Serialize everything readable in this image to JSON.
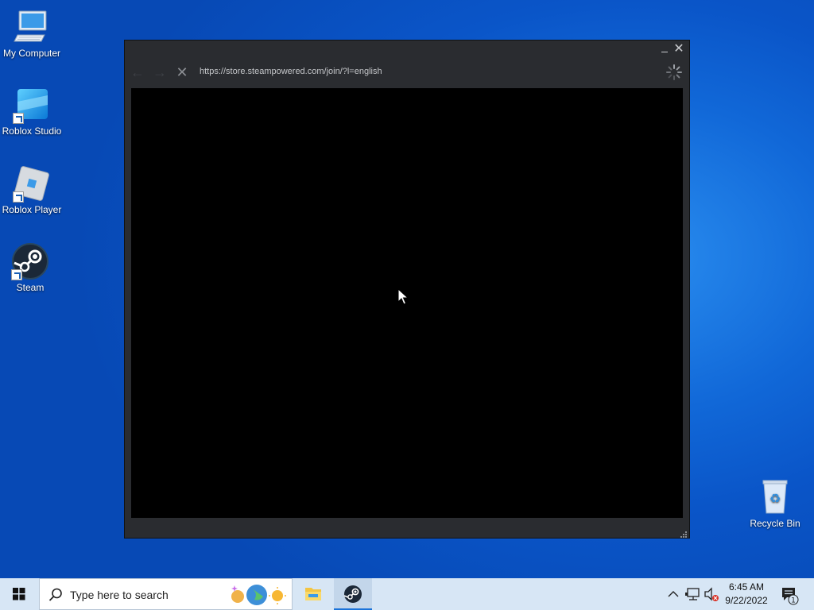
{
  "desktop": {
    "icons": [
      {
        "label": "My Computer"
      },
      {
        "label": "Roblox Studio"
      },
      {
        "label": "Roblox Player"
      },
      {
        "label": "Steam"
      },
      {
        "label": "Recycle Bin"
      }
    ]
  },
  "steam_window": {
    "minimize_glyph": "_",
    "close_glyph": "✕",
    "back_glyph": "←",
    "forward_glyph": "→",
    "stop_glyph": "✕",
    "url": "https://store.steampowered.com/join/?l=english"
  },
  "taskbar": {
    "search_placeholder": "Type here to search",
    "clock_time": "6:45 AM",
    "clock_date": "9/22/2022",
    "notification_count": "1"
  },
  "colors": {
    "desktop_bg": "#0a55c8",
    "window_bg": "#2a2c30",
    "webview_bg": "#000000",
    "taskbar_bg": "#d7e6f5",
    "steam_accent": "#1b2838"
  }
}
